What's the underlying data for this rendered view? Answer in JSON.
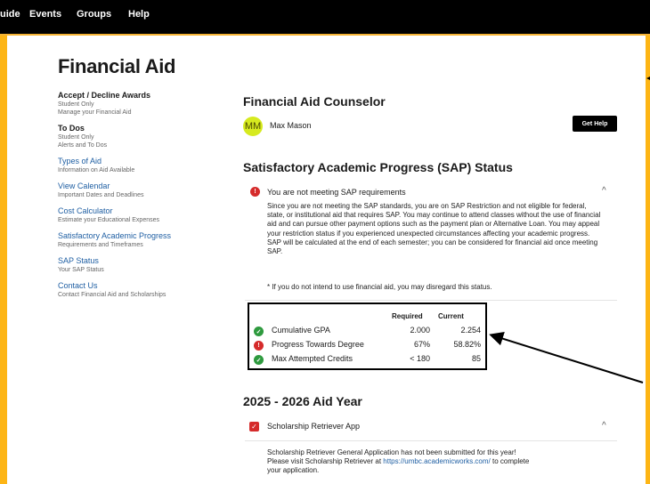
{
  "topnav": {
    "items": [
      "uide",
      "Events",
      "Groups",
      "Help"
    ]
  },
  "page": {
    "title": "Financial Aid"
  },
  "sidebar": {
    "items": [
      {
        "title": "Accept / Decline Awards",
        "sub1": "Student Only",
        "sub2": "Manage your Financial Aid"
      },
      {
        "title": "To Dos",
        "sub1": "Student Only",
        "sub2": "Alerts and To Dos"
      },
      {
        "title": "Types of Aid",
        "sub1": "Information on Aid Available"
      },
      {
        "title": "View Calendar",
        "sub1": "Important Dates and Deadlines"
      },
      {
        "title": "Cost Calculator",
        "sub1": "Estimate your Educational Expenses"
      },
      {
        "title": "Satisfactory Academic Progress",
        "sub1": "Requirements and Timeframes"
      },
      {
        "title": "SAP Status",
        "sub1": "Your SAP Status"
      },
      {
        "title": "Contact Us",
        "sub1": "Contact Financial Aid and Scholarships"
      }
    ]
  },
  "counselor": {
    "heading": "Financial Aid Counselor",
    "initials": "MM",
    "name": "Max Mason",
    "help_label": "Get Help"
  },
  "sap": {
    "heading": "Satisfactory Academic Progress (SAP) Status",
    "alert_title": "You are not meeting SAP requirements",
    "alert_body": "Since you are not meeting the SAP standards, you are on SAP Restriction and not eligible for federal, state, or institutional aid that requires SAP. You may continue to attend classes without the use of financial aid and can pursue other payment options such as the payment plan or Alternative Loan. You may appeal your restriction status if you experienced unexpected circumstances affecting your academic progress. SAP will be calculated at the end of each semester; you can be considered for financial aid once meeting SAP.",
    "note": "* If you do not intend to use financial aid, you may disregard this status.",
    "table": {
      "col_required": "Required",
      "col_current": "Current",
      "rows": [
        {
          "label": "Cumulative GPA",
          "required": "2.000",
          "current": "2.254",
          "status": "ok"
        },
        {
          "label": "Progress Towards Degree",
          "required": "67%",
          "current": "58.82%",
          "status": "error"
        },
        {
          "label": "Max Attempted Credits",
          "required": "< 180",
          "current": "85",
          "status": "ok"
        }
      ]
    }
  },
  "aid_year": {
    "heading": "2025 - 2026 Aid Year",
    "app_title": "Scholarship Retriever App",
    "body_line1": "Scholarship Retriever General Application has not been submitted for this year!",
    "body_line2_pre": "Please visit Scholarship Retriever at ",
    "body_link": "https://umbc.academicworks.com/",
    "body_line2_post": " to complete",
    "body_line3": "your application."
  },
  "colors": {
    "accent": "#fdb515",
    "link": "#1f5fa3",
    "error": "#d52b2b",
    "success": "#2e9a3e"
  }
}
